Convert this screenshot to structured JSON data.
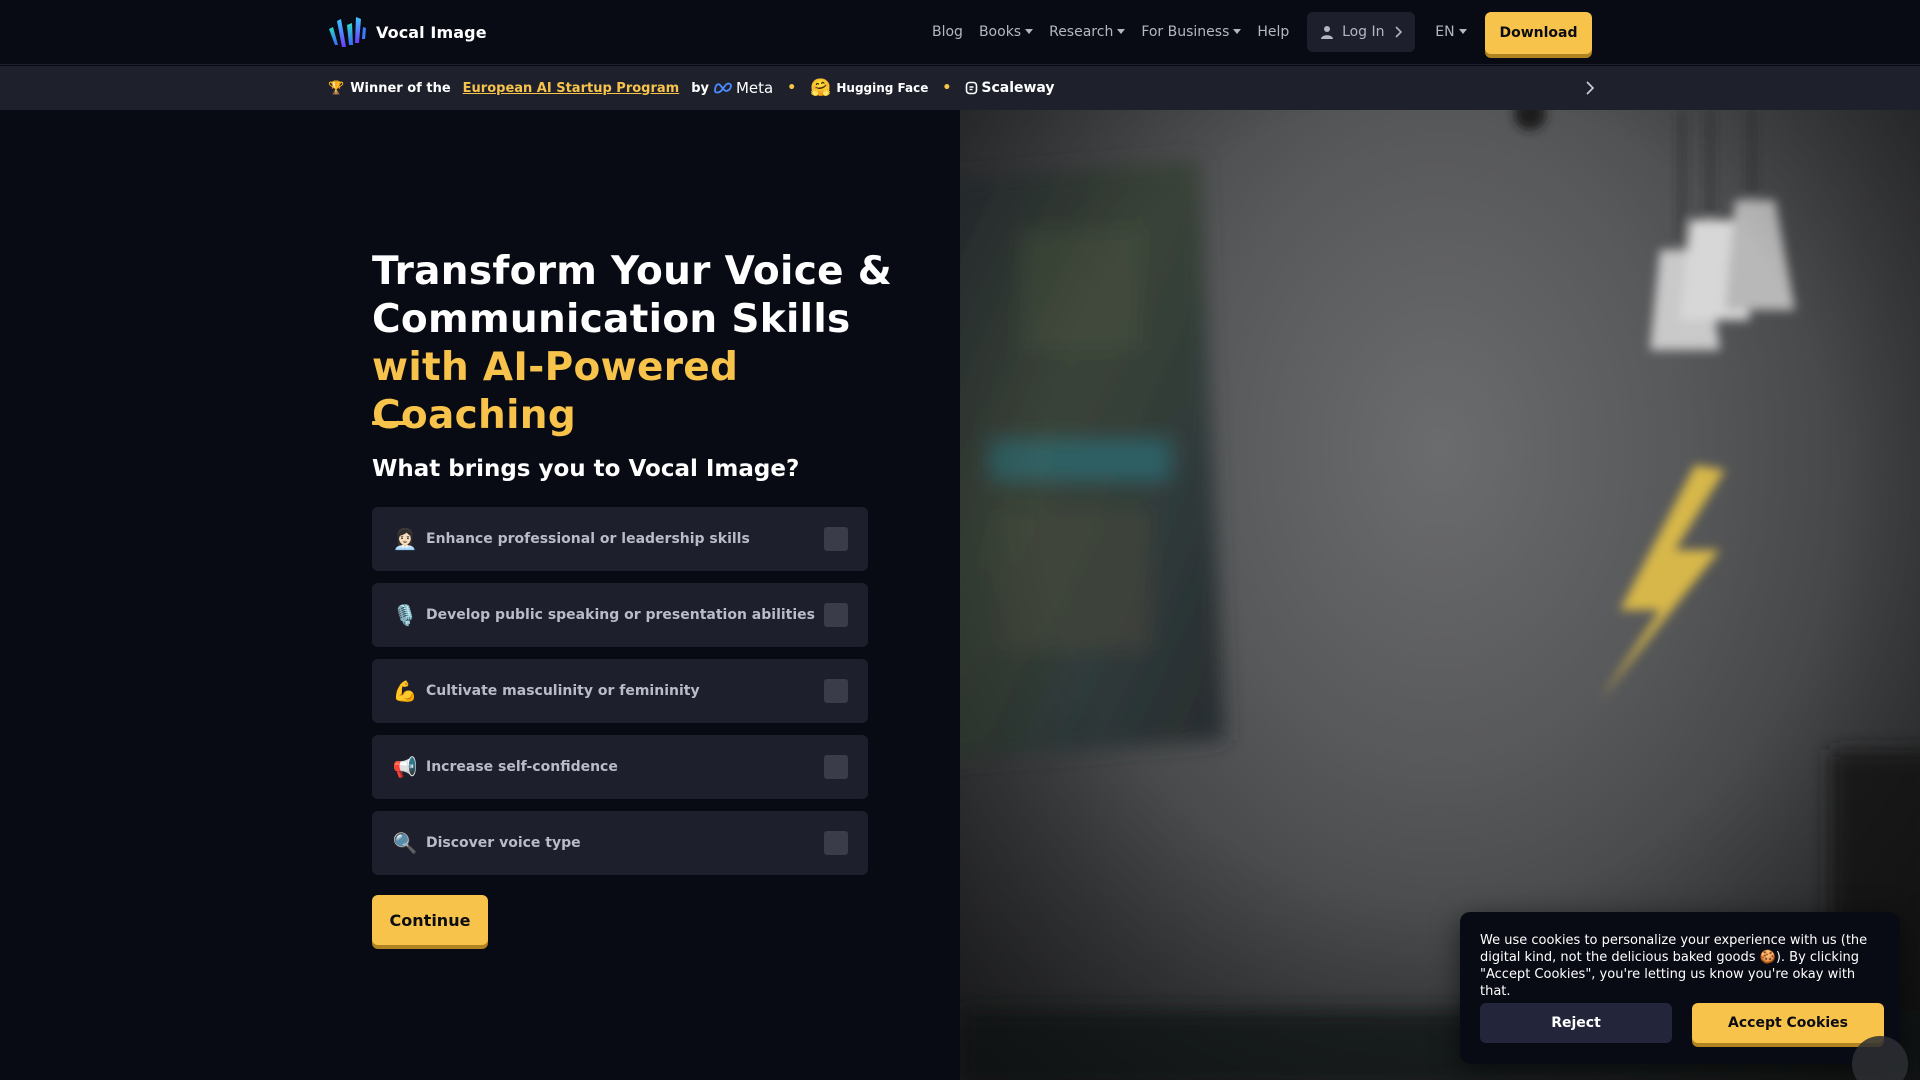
{
  "brand": {
    "name": "Vocal Image"
  },
  "nav": {
    "items": [
      {
        "label": "Blog",
        "dropdown": false
      },
      {
        "label": "Books",
        "dropdown": true
      },
      {
        "label": "Research",
        "dropdown": true
      },
      {
        "label": "For Business",
        "dropdown": true
      },
      {
        "label": "Help",
        "dropdown": false
      }
    ],
    "login_label": "Log In",
    "language": "EN",
    "download_label": "Download"
  },
  "announcement": {
    "prefix": "Winner of the",
    "link_text": "European AI Startup Program",
    "by": "by",
    "partners": [
      "Meta",
      "Hugging Face",
      "Scaleway"
    ],
    "icons": {
      "trophy": "trophy-icon",
      "next": "chevron-right-icon"
    }
  },
  "hero": {
    "headline_line1": "Transform Your Voice &",
    "headline_line2": "Communication Skills",
    "headline_accent": "with AI-Powered Coaching",
    "question": "What brings you to Vocal Image?",
    "options": [
      {
        "icon": "👩🏻‍💼",
        "icon_name": "businesswoman-icon",
        "label": "Enhance professional or leadership skills"
      },
      {
        "icon": "🎙️",
        "icon_name": "microphone-icon",
        "label": "Develop public speaking or presentation abilities"
      },
      {
        "icon": "💪",
        "icon_name": "flexed-biceps-icon",
        "label": "Cultivate masculinity or femininity"
      },
      {
        "icon": "📢",
        "icon_name": "megaphone-icon",
        "label": "Increase self-confidence"
      },
      {
        "icon": "🔍",
        "icon_name": "magnifying-glass-icon",
        "label": "Discover voice type"
      }
    ],
    "continue_label": "Continue"
  },
  "cookie": {
    "text": "We use cookies to personalize your experience with us (the digital kind, not the delicious baked goods 🍪). By clicking \"Accept Cookies\", you're letting us know you're okay with that.",
    "reject_label": "Reject",
    "accept_label": "Accept Cookies"
  },
  "colors": {
    "background": "#090b14",
    "accent": "#f7c34b",
    "card": "#1d202c",
    "banner": "#1e212c"
  }
}
